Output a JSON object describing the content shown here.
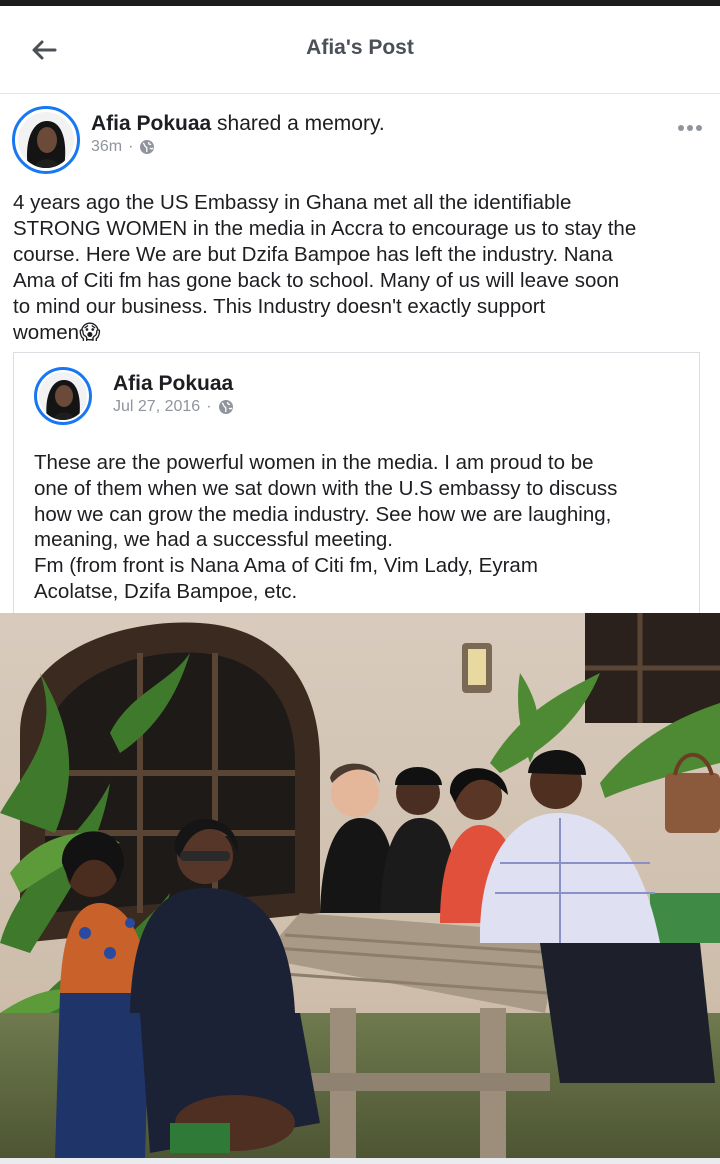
{
  "header": {
    "title": "Afia's Post"
  },
  "post": {
    "author": "Afia Pokuaa",
    "action": " shared a memory.",
    "time": "36m",
    "separator": "·",
    "text": "4 years ago the US Embassy in Ghana met all the identifiable\nSTRONG WOMEN in the media in Accra to encourage us to stay the\ncourse. Here We are but Dzifa Bampoe has left the industry. Nana\nAma of Citi fm has gone back to school. Many of us will leave soon\nto mind our business. This Industry doesn't exactly support\nwomen",
    "emoji": "😱"
  },
  "shared": {
    "author": "Afia Pokuaa",
    "date": "Jul 27, 2016",
    "separator": "·",
    "text": "These are the powerful women in the media. I am proud to be\none of them when we sat down with the U.S embassy to discuss\nhow we can grow the media industry. See how we are laughing,\nmeaning, we had a successful meeting.\nFm (from front is Nana Ama of Citi fm, Vim Lady, Eyram\nAcolatse, Dzifa Bampoe, etc."
  },
  "icons": {
    "back": "arrow-left-icon",
    "more": "more-horizontal-icon",
    "privacy": "globe-icon"
  },
  "colors": {
    "accent": "#1877f2",
    "meta_text": "#90949c",
    "title_text": "#4b4f56"
  }
}
